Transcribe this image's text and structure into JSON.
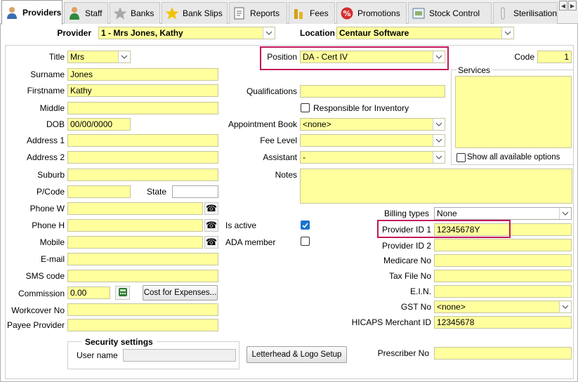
{
  "tabs": [
    {
      "label": "Providers",
      "icon": "person-icon",
      "active": true
    },
    {
      "label": "Staff",
      "icon": "staff-icon"
    },
    {
      "label": "Banks",
      "icon": "star-icon"
    },
    {
      "label": "Bank Slips",
      "icon": "star-icon"
    },
    {
      "label": "Reports",
      "icon": "report-icon"
    },
    {
      "label": "Fees",
      "icon": "coins-icon"
    },
    {
      "label": "Promotions",
      "icon": "percent-icon"
    },
    {
      "label": "Stock Control",
      "icon": "box-icon"
    },
    {
      "label": "Sterilisation",
      "icon": "tube-icon"
    }
  ],
  "header": {
    "provider_label": "Provider",
    "provider_value": "1 - Mrs Jones, Kathy",
    "location_label": "Location",
    "location_value": "Centaur Software"
  },
  "left": {
    "title_label": "Title",
    "title_value": "Mrs",
    "surname_label": "Surname",
    "surname_value": "Jones",
    "firstname_label": "Firstname",
    "firstname_value": "Kathy",
    "middle_label": "Middle",
    "middle_value": "",
    "dob_label": "DOB",
    "dob_value": "00/00/0000",
    "address1_label": "Address 1",
    "address1_value": "",
    "address2_label": "Address 2",
    "address2_value": "",
    "suburb_label": "Suburb",
    "suburb_value": "",
    "postcode_label": "P/Code",
    "postcode_value": "",
    "state_label": "State",
    "state_value": "",
    "phonew_label": "Phone W",
    "phonew_value": "",
    "phoneh_label": "Phone H",
    "phoneh_value": "",
    "mobile_label": "Mobile",
    "mobile_value": "",
    "email_label": "E-mail",
    "email_value": "",
    "sms_label": "SMS code",
    "sms_value": "",
    "commission_label": "Commission",
    "commission_value": "0.00",
    "cost_button": "Cost for Expenses...",
    "workcover_label": "Workcover No",
    "workcover_value": "",
    "payee_label": "Payee Provider",
    "payee_value": ""
  },
  "security": {
    "title": "Security settings",
    "username_label": "User name",
    "username_value": ""
  },
  "middle": {
    "position_label": "Position",
    "position_value": "DA - Cert IV",
    "qualifications_label": "Qualifications",
    "qualifications_value": "",
    "responsible_label": "Responsible for Inventory",
    "appointment_label": "Appointment Book",
    "appointment_value": "<none>",
    "fee_label": "Fee Level",
    "fee_value": "",
    "assistant_label": "Assistant",
    "assistant_value": "-",
    "notes_label": "Notes",
    "notes_value": "",
    "is_active_label": "Is active",
    "ada_label": "ADA member",
    "letterhead_button": "Letterhead & Logo Setup"
  },
  "right": {
    "code_label": "Code",
    "code_value": "1",
    "services_label": "Services",
    "show_all_label": "Show all available options",
    "billing_label": "Billing types",
    "billing_value": "None",
    "provider_id1_label": "Provider ID 1",
    "provider_id1_value": "12345678Y",
    "provider_id2_label": "Provider ID 2",
    "provider_id2_value": "",
    "medicare_label": "Medicare No",
    "medicare_value": "",
    "taxfile_label": "Tax File No",
    "taxfile_value": "",
    "ein_label": "E.I.N.",
    "ein_value": "",
    "gst_label": "GST No",
    "gst_value": "<none>",
    "hicaps_label": "HICAPS Merchant ID",
    "hicaps_value": "12345678",
    "prescriber_label": "Prescriber No",
    "prescriber_value": ""
  },
  "colors": {
    "field": "#ffff9e",
    "highlight": "#c2185b",
    "checkbox": "#1a73d0"
  }
}
